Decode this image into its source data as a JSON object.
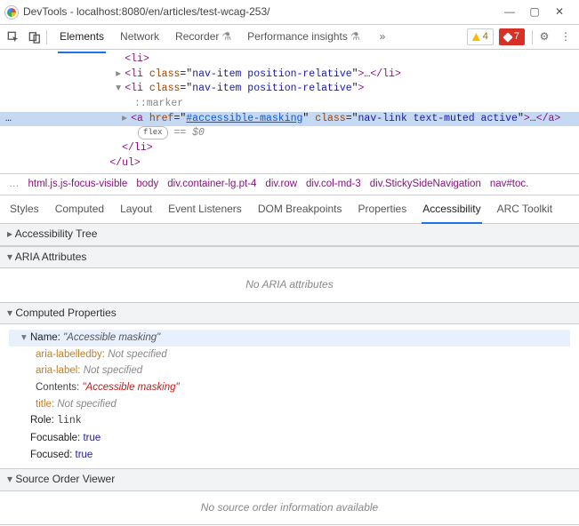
{
  "window": {
    "title": "DevTools - localhost:8080/en/articles/test-wcag-253/"
  },
  "tabs": {
    "items": [
      "Elements",
      "Network",
      "Recorder",
      "Performance insights"
    ],
    "active": 0
  },
  "counts": {
    "warnings": "4",
    "errors": "7"
  },
  "dom": {
    "l0": "<li>",
    "l1_open": "<li class=\"nav-item position-relative\">",
    "l1_close": "…</li>",
    "l2_open": "<li class=\"nav-item position-relative\">",
    "marker": "::marker",
    "a_pre": "<a href=\"",
    "a_href": "#accessible-masking",
    "a_mid": "\" class=\"nav-link text-muted active\">",
    "a_close": "…</a>",
    "pill": "flex",
    "eq0": " == $0",
    "li_close": "</li>",
    "ul_close": "</ul>"
  },
  "crumb": [
    "…",
    "html.js.js-focus-visible",
    "body",
    "div.container-lg.pt-4",
    "div.row",
    "div.col-md-3",
    "div.StickySideNavigation",
    "nav#toc."
  ],
  "subtabs": {
    "items": [
      "Styles",
      "Computed",
      "Layout",
      "Event Listeners",
      "DOM Breakpoints",
      "Properties",
      "Accessibility",
      "ARC Toolkit"
    ],
    "active": 6
  },
  "a11y": {
    "tree": "Accessibility Tree",
    "aria": "ARIA Attributes",
    "aria_empty": "No ARIA attributes",
    "computed": "Computed Properties",
    "name_key": "Name:",
    "name_val": "\"Accessible masking\"",
    "rows": {
      "labelledby_k": "aria-labelledby:",
      "labelledby_v": "Not specified",
      "label_k": "aria-label:",
      "label_v": "Not specified",
      "contents_k": "Contents:",
      "contents_v": "\"Accessible masking\"",
      "title_k": "title:",
      "title_v": "Not specified",
      "role_k": "Role:",
      "role_v": "link",
      "focusable_k": "Focusable:",
      "focusable_v": "true",
      "focused_k": "Focused:",
      "focused_v": "true"
    },
    "source": "Source Order Viewer",
    "source_empty": "No source order information available"
  }
}
